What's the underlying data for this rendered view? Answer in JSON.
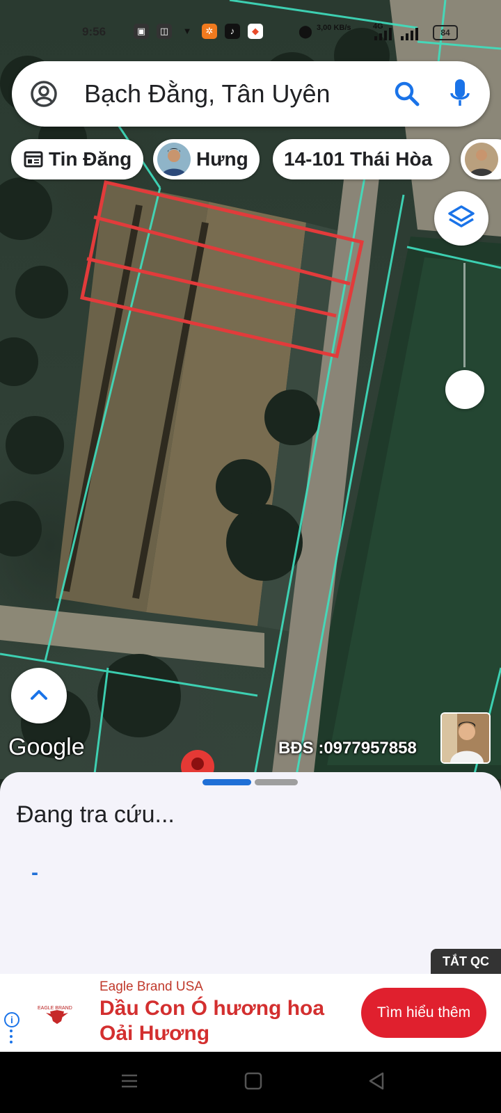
{
  "status_bar": {
    "time": "9:56",
    "speed": "3,00\nKB/s",
    "network": "4G",
    "battery": "84"
  },
  "search": {
    "query": "Bạch Đằng, Tân Uyên",
    "icons": [
      "account-circle-icon",
      "search-icon",
      "mic-icon"
    ]
  },
  "chips": [
    {
      "label": "Tin Đăng",
      "icon": "listing-icon"
    },
    {
      "label": "Hưng",
      "icon": "avatar"
    },
    {
      "label": "14-101 Thái Hòa",
      "icon": ""
    },
    {
      "label": "",
      "icon": "avatar"
    }
  ],
  "map": {
    "attribution": "Google",
    "overlay_label": "BĐS :0977957858",
    "plot_outline_color": "#e23b3b",
    "parcel_line_color": "#3fe0c0"
  },
  "sheet": {
    "status": "Đang tra cứu...",
    "placeholder": "-"
  },
  "ad": {
    "close_label": "TẮT QC",
    "brand": "Eagle Brand USA",
    "headline": "Dầu Con Ó hương hoa Oải Hương",
    "cta": "Tìm hiểu thêm",
    "logo_text": "EAGLE BRAND"
  }
}
